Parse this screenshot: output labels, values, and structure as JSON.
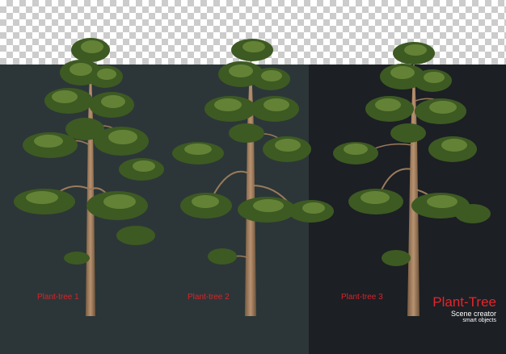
{
  "trees": [
    {
      "label": "Plant-tree 1"
    },
    {
      "label": "Plant-tree 2"
    },
    {
      "label": "Plant-tree 3"
    }
  ],
  "brand": {
    "title": "Plant-Tree",
    "subtitle": "Scene creator",
    "tagline": "smart objects"
  },
  "colors": {
    "panel_left": "#2c3638",
    "panel_right": "#1c1f24",
    "label_red": "#d8232a",
    "trunk": "#a27f5e",
    "foliage_dark": "#3f5a22",
    "foliage_light": "#6f8a3c"
  }
}
